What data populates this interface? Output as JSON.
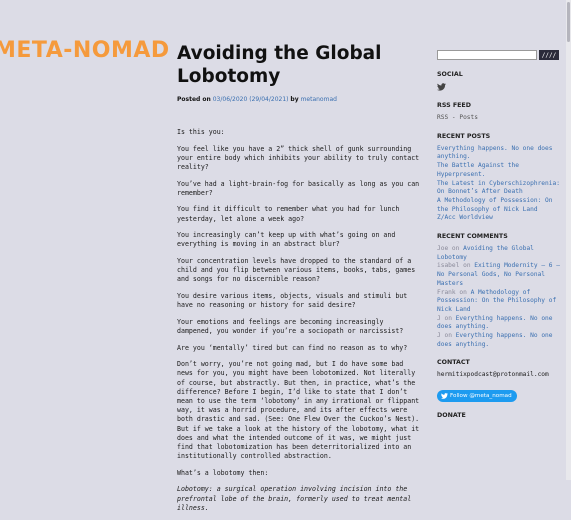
{
  "site": {
    "logo_text": "META-NOMAD"
  },
  "post": {
    "title": "Avoiding the Global Lobotomy",
    "meta": {
      "posted_on_label": "Posted on",
      "date": "03/06/2020 (29/04/2021)",
      "by_label": "by",
      "author": "metanomad"
    },
    "paragraphs": {
      "p1": "Is this you:",
      "p2": "You feel like you have a 2” thick shell of gunk surrounding your entire body which inhibits your ability to truly contact reality?",
      "p3": "You’ve had a light-brain-fog for basically as long as you can remember?",
      "p4": "You find it difficult to remember what you had for lunch yesterday, let alone a week ago?",
      "p5": "You increasingly can’t keep up with what’s going on and everything is moving in an abstract blur?",
      "p6": "Your concentration levels have dropped to the standard of a child and you flip between various items, books, tabs, games and songs for no discernible reason?",
      "p7": "You desire various items, objects, visuals and stimuli but have no reasoning or history for said desire?",
      "p8": "Your emotions and feelings are becoming increasingly dampened, you wonder if you’re a sociopath or narcissist?",
      "p9": "Are you ‘mentally’ tired but can find no reason as to why?",
      "p10": "Don’t worry, you’re not going mad, but I do have some bad news for you, you might have been lobotomized. Not literally of course, but abstractly. But then, in practice, what’s the difference? Before I begin, I’d like to state that I don’t mean to use the term ‘lobotomy’ in any irrational or flippant way, it was a horrid procedure, and its after effects were both drastic and sad. (See: One Flew Over the Cuckoo’s Nest). But if we take a look at the history of the lobotomy, what it does and what the intended outcome of it was, we might just find that lobotomization has been deterritorialized into an institutionally controlled abstraction.",
      "p11": "What’s a lobotomy then:",
      "p12": "Lobotomy: a surgical operation involving incision into the prefrontal lobe of the brain, formerly used to treat mental illness."
    }
  },
  "sidebar": {
    "search_button_label": "////",
    "social_title": "SOCIAL",
    "rss_title": "RSS FEED",
    "rss_link": "RSS - Posts",
    "recent_posts_title": "RECENT POSTS",
    "recent_posts": [
      "Everything happens. No one does anything.",
      "The Battle Against the Hyperpresent.",
      "The Latest in Cyberschizophrenia: On Bonnet’s After Death",
      "A Methodology of Possession: On the Philosophy of Nick Land",
      "Z/Acc Worldview"
    ],
    "recent_comments_title": "RECENT COMMENTS",
    "recent_comments": [
      {
        "author": "Joe",
        "on": "on",
        "post": "Avoiding the Global Lobotomy"
      },
      {
        "author": "isabel",
        "on": "on",
        "post": "Exiting Modernity – 6 – No Personal Gods, No Personal Masters"
      },
      {
        "author": "Frank",
        "on": "on",
        "post": "A Methodology of Possession: On the Philosophy of Nick Land"
      },
      {
        "author": "J",
        "on": "on",
        "post": "Everything happens. No one does anything."
      },
      {
        "author": "J",
        "on": "on",
        "post": "Everything happens. No one does anything."
      }
    ],
    "contact_title": "CONTACT",
    "contact_email": "hermitixpodcast@protonmail.com",
    "follow_label": "Follow @meta_nomad",
    "donate_title": "DONATE"
  },
  "colors": {
    "accent": "#f59a3c",
    "link": "#3a6fb0",
    "background": "#dcdce6",
    "twitter": "#1d9bf0"
  }
}
